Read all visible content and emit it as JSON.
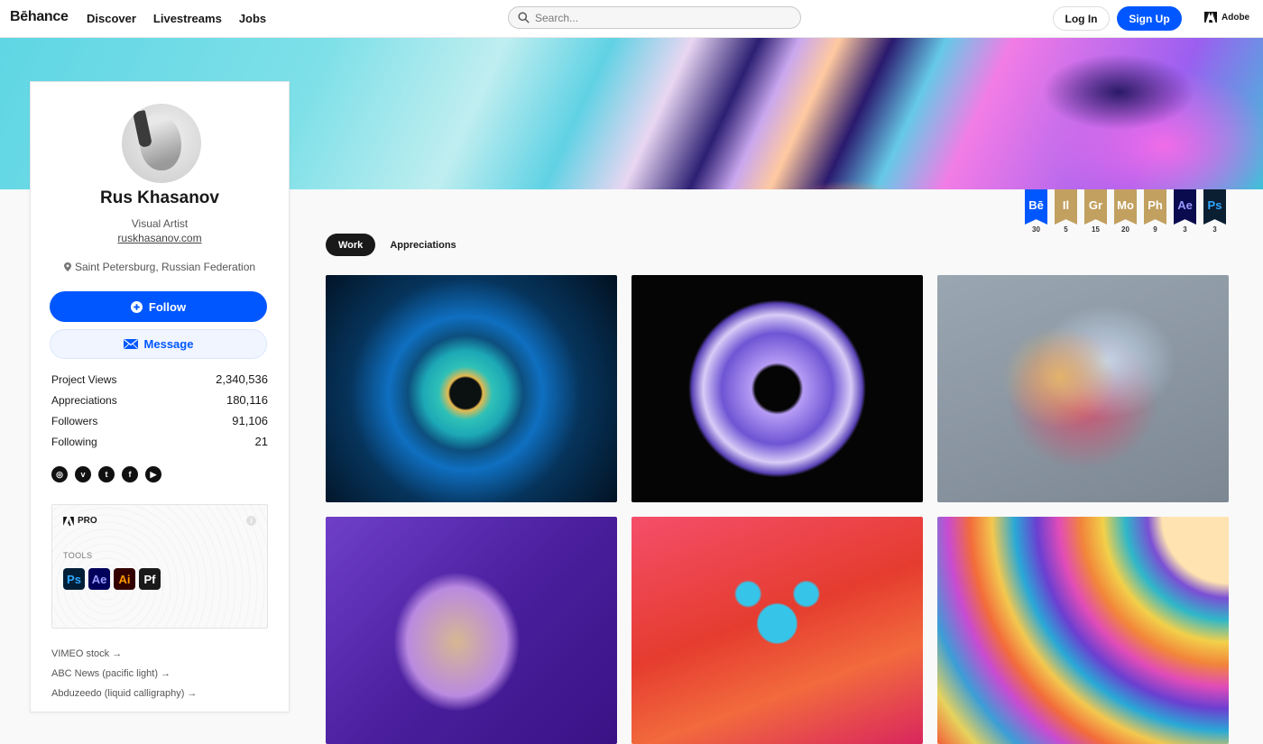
{
  "header": {
    "logo": "Bēhance",
    "nav": [
      "Discover",
      "Livestreams",
      "Jobs"
    ],
    "search": {
      "placeholder": "Search...",
      "value": ""
    },
    "login_label": "Log In",
    "signup_label": "Sign Up",
    "adobe_label": "Adobe",
    "accent": "#0057ff"
  },
  "profile": {
    "name": "Rus Khasanov",
    "occupation": "Visual Artist",
    "website": "ruskhasanov.com",
    "location": "Saint Petersburg, Russian Federation",
    "follow_label": "Follow",
    "message_label": "Message",
    "stats": [
      {
        "label": "Project Views",
        "value": "2,340,536"
      },
      {
        "label": "Appreciations",
        "value": "180,116"
      },
      {
        "label": "Followers",
        "value": "91,106"
      },
      {
        "label": "Following",
        "value": "21"
      }
    ],
    "social": [
      {
        "icon": "instagram-icon",
        "glyph": "◎"
      },
      {
        "icon": "vimeo-icon",
        "glyph": "v"
      },
      {
        "icon": "twitter-icon",
        "glyph": "t"
      },
      {
        "icon": "facebook-icon",
        "glyph": "f"
      },
      {
        "icon": "youtube-icon",
        "glyph": "▶"
      }
    ],
    "pro": {
      "label": "PRO",
      "tools_label": "TOOLS",
      "tools": [
        {
          "abbr": "Ps",
          "bg": "#001e36",
          "fg": "#31a8ff"
        },
        {
          "abbr": "Ae",
          "bg": "#00005b",
          "fg": "#9999ff"
        },
        {
          "abbr": "Ai",
          "bg": "#330000",
          "fg": "#ff9a00"
        },
        {
          "abbr": "Pf",
          "bg": "#1a1a1a",
          "fg": "#ffffff"
        }
      ]
    },
    "links": [
      "VIMEO stock →",
      "ABC News (pacific light) →",
      "Abduzeedo (liquid calligraphy) →"
    ]
  },
  "badges": [
    {
      "abbr": "Bē",
      "count": "30",
      "bg": "#0057ff",
      "fg": "#ffffff"
    },
    {
      "abbr": "Il",
      "count": "5",
      "bg": "#c2a060",
      "fg": "#ffffff"
    },
    {
      "abbr": "Gr",
      "count": "15",
      "bg": "#c2a060",
      "fg": "#ffffff"
    },
    {
      "abbr": "Mo",
      "count": "20",
      "bg": "#c2a060",
      "fg": "#ffffff"
    },
    {
      "abbr": "Ph",
      "count": "9",
      "bg": "#c2a060",
      "fg": "#ffffff"
    },
    {
      "abbr": "Ae",
      "count": "3",
      "bg": "#0a0a4f",
      "fg": "#9999ff"
    },
    {
      "abbr": "Ps",
      "count": "3",
      "bg": "#0b1f33",
      "fg": "#31a8ff"
    }
  ],
  "tabs": [
    {
      "label": "Work",
      "active": true
    },
    {
      "label": "Appreciations",
      "active": false
    }
  ],
  "projects": [
    {
      "name": "eye-iris-artwork"
    },
    {
      "name": "purple-ink-ring-artwork"
    },
    {
      "name": "fingerprint-heart-artwork"
    },
    {
      "name": "purple-heart-fluid-artwork"
    },
    {
      "name": "blue-mouse-on-red-artwork"
    },
    {
      "name": "rainbow-oil-film-artwork"
    }
  ]
}
